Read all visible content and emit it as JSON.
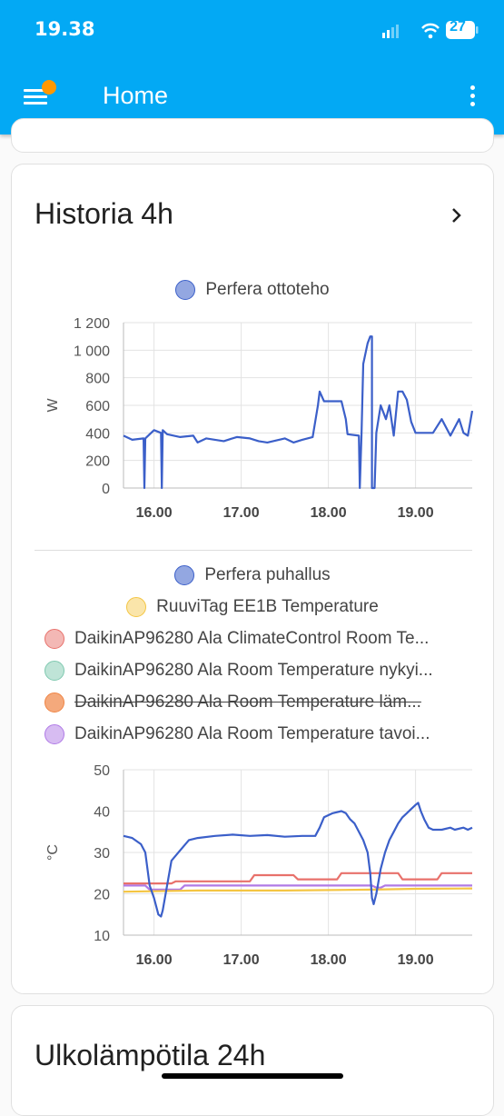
{
  "status_bar": {
    "time": "19.38",
    "battery": "27"
  },
  "app_bar": {
    "title": "Home"
  },
  "history_card": {
    "title": "Historia 4h",
    "power_chart_legend": [
      "Perfera ottoteho"
    ],
    "temp_chart_legend": [
      "Perfera puhallus",
      "RuuviTag EE1B Temperature",
      "DaikinAP96280 Ala ClimateControl Room Te...",
      "DaikinAP96280 Ala Room Temperature nykyi...",
      "DaikinAP96280 Ala Room Temperature läm...",
      "DaikinAP96280 Ala Room Temperature tavoi..."
    ]
  },
  "outdoor_card": {
    "title": "Ulkolämpötila 24h"
  },
  "colors": {
    "app_bar": "#03a9f4",
    "notification": "#ff9800",
    "series_blue": "#3b5fc9",
    "series_yellow": "#f4c542",
    "series_red": "#e8716b",
    "series_teal": "#7fc9b0",
    "series_orange": "#f08545",
    "series_purple": "#b07ae6"
  },
  "chart_data": [
    {
      "type": "line",
      "ylabel": "W",
      "yticks": [
        "0",
        "200",
        "400",
        "600",
        "800",
        "1 000",
        "1 200"
      ],
      "ylim": [
        0,
        1200
      ],
      "xticks": [
        "16.00",
        "17.00",
        "18.00",
        "19.00"
      ],
      "x_unit": "hours",
      "xlim": [
        15.65,
        19.65
      ],
      "grid": true,
      "legend_position": "top",
      "series": [
        {
          "name": "Perfera ottoteho",
          "color": "#3b5fc9",
          "points": [
            [
              15.65,
              380
            ],
            [
              15.75,
              350
            ],
            [
              15.88,
              360
            ],
            [
              15.89,
              0
            ],
            [
              15.9,
              360
            ],
            [
              16.0,
              420
            ],
            [
              16.08,
              400
            ],
            [
              16.09,
              0
            ],
            [
              16.1,
              420
            ],
            [
              16.15,
              390
            ],
            [
              16.3,
              370
            ],
            [
              16.45,
              380
            ],
            [
              16.5,
              330
            ],
            [
              16.6,
              360
            ],
            [
              16.8,
              340
            ],
            [
              16.95,
              370
            ],
            [
              17.1,
              360
            ],
            [
              17.2,
              340
            ],
            [
              17.3,
              330
            ],
            [
              17.5,
              360
            ],
            [
              17.6,
              330
            ],
            [
              17.7,
              350
            ],
            [
              17.82,
              370
            ],
            [
              17.88,
              600
            ],
            [
              17.9,
              700
            ],
            [
              17.95,
              630
            ],
            [
              18.05,
              630
            ],
            [
              18.15,
              630
            ],
            [
              18.2,
              500
            ],
            [
              18.22,
              390
            ],
            [
              18.35,
              380
            ],
            [
              18.36,
              0
            ],
            [
              18.38,
              390
            ],
            [
              18.4,
              900
            ],
            [
              18.45,
              1050
            ],
            [
              18.48,
              1100
            ],
            [
              18.5,
              1100
            ],
            [
              18.5,
              0
            ],
            [
              18.53,
              0
            ],
            [
              18.55,
              400
            ],
            [
              18.6,
              600
            ],
            [
              18.66,
              500
            ],
            [
              18.7,
              600
            ],
            [
              18.75,
              380
            ],
            [
              18.8,
              700
            ],
            [
              18.85,
              700
            ],
            [
              18.9,
              640
            ],
            [
              18.95,
              480
            ],
            [
              19.0,
              400
            ],
            [
              19.1,
              400
            ],
            [
              19.2,
              400
            ],
            [
              19.3,
              500
            ],
            [
              19.4,
              380
            ],
            [
              19.5,
              500
            ],
            [
              19.55,
              400
            ],
            [
              19.6,
              380
            ],
            [
              19.65,
              560
            ]
          ]
        }
      ]
    },
    {
      "type": "line",
      "ylabel": "°C",
      "yticks": [
        "10",
        "20",
        "30",
        "40",
        "50"
      ],
      "ylim": [
        10,
        50
      ],
      "xticks": [
        "16.00",
        "17.00",
        "18.00",
        "19.00"
      ],
      "xlim": [
        15.65,
        19.65
      ],
      "grid": true,
      "legend_position": "top",
      "series": [
        {
          "name": "Perfera puhallus",
          "color": "#3b5fc9",
          "points": [
            [
              15.65,
              34
            ],
            [
              15.75,
              33.5
            ],
            [
              15.85,
              32
            ],
            [
              15.9,
              30
            ],
            [
              15.95,
              22
            ],
            [
              16.0,
              19
            ],
            [
              16.05,
              15
            ],
            [
              16.08,
              14.5
            ],
            [
              16.1,
              16
            ],
            [
              16.15,
              22
            ],
            [
              16.2,
              28
            ],
            [
              16.3,
              30.5
            ],
            [
              16.4,
              33
            ],
            [
              16.5,
              33.5
            ],
            [
              16.7,
              34
            ],
            [
              16.9,
              34.3
            ],
            [
              17.1,
              34
            ],
            [
              17.3,
              34.2
            ],
            [
              17.5,
              33.8
            ],
            [
              17.7,
              34
            ],
            [
              17.85,
              34
            ],
            [
              17.9,
              36
            ],
            [
              17.95,
              38.5
            ],
            [
              18.05,
              39.5
            ],
            [
              18.15,
              40
            ],
            [
              18.2,
              39.5
            ],
            [
              18.25,
              38
            ],
            [
              18.3,
              37
            ],
            [
              18.35,
              35
            ],
            [
              18.4,
              33
            ],
            [
              18.45,
              30
            ],
            [
              18.48,
              25
            ],
            [
              18.5,
              19
            ],
            [
              18.52,
              17.5
            ],
            [
              18.55,
              20
            ],
            [
              18.6,
              26
            ],
            [
              18.65,
              30
            ],
            [
              18.7,
              33
            ],
            [
              18.75,
              35
            ],
            [
              18.8,
              37
            ],
            [
              18.85,
              38.5
            ],
            [
              18.9,
              39.5
            ],
            [
              18.95,
              40.5
            ],
            [
              19.0,
              41.5
            ],
            [
              19.03,
              42
            ],
            [
              19.06,
              40
            ],
            [
              19.1,
              38
            ],
            [
              19.15,
              36
            ],
            [
              19.2,
              35.5
            ],
            [
              19.3,
              35.5
            ],
            [
              19.4,
              36
            ],
            [
              19.45,
              35.5
            ],
            [
              19.55,
              36
            ],
            [
              19.6,
              35.5
            ],
            [
              19.65,
              36
            ]
          ]
        },
        {
          "name": "RuuviTag EE1B Temperature",
          "color": "#f4c542",
          "points": [
            [
              15.65,
              20.5
            ],
            [
              16.5,
              20.8
            ],
            [
              17.5,
              20.8
            ],
            [
              18.5,
              21.0
            ],
            [
              19.0,
              21.2
            ],
            [
              19.65,
              21.3
            ]
          ]
        },
        {
          "name": "DaikinAP96280 Ala ClimateControl Room Te...",
          "color": "#e8716b",
          "points": [
            [
              15.65,
              22.5
            ],
            [
              16.2,
              22.5
            ],
            [
              16.25,
              23
            ],
            [
              17.1,
              23
            ],
            [
              17.15,
              24.5
            ],
            [
              17.6,
              24.5
            ],
            [
              17.65,
              23.5
            ],
            [
              18.1,
              23.5
            ],
            [
              18.15,
              25
            ],
            [
              18.8,
              25
            ],
            [
              18.85,
              23.5
            ],
            [
              19.25,
              23.5
            ],
            [
              19.3,
              25
            ],
            [
              19.65,
              25
            ]
          ]
        },
        {
          "name": "DaikinAP96280 Ala Room Temperature nykyi...",
          "color": "#7fc9b0",
          "points": []
        },
        {
          "name": "DaikinAP96280 Ala Room Temperature läm...",
          "color": "#f08545",
          "hidden": true,
          "points": []
        },
        {
          "name": "DaikinAP96280 Ala Room Temperature tavoi...",
          "color": "#b07ae6",
          "points": [
            [
              15.65,
              22
            ],
            [
              15.9,
              22
            ],
            [
              15.95,
              21
            ],
            [
              16.3,
              21
            ],
            [
              16.35,
              22
            ],
            [
              18.0,
              22
            ],
            [
              18.5,
              22
            ],
            [
              18.55,
              21.5
            ],
            [
              18.6,
              21.5
            ],
            [
              18.65,
              22
            ],
            [
              19.65,
              22
            ]
          ]
        }
      ]
    }
  ]
}
